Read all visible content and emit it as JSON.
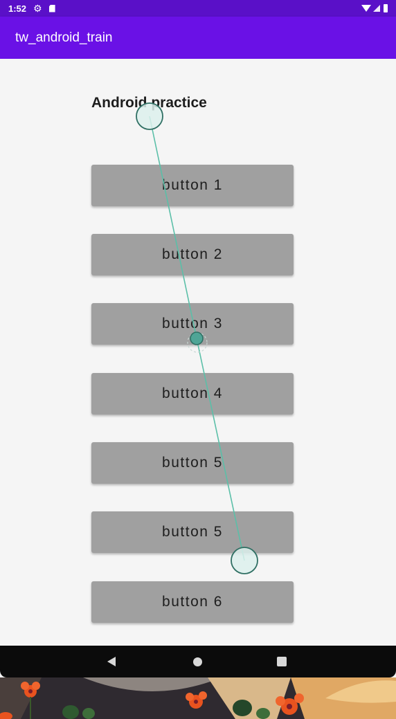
{
  "status_bar": {
    "time": "1:52",
    "icons": [
      "gear-icon",
      "sd-card-icon",
      "wifi-icon",
      "signal-icon",
      "battery-icon"
    ]
  },
  "app_bar": {
    "title": "tw_android_train",
    "color": "#6a11e6"
  },
  "main": {
    "heading": "Android practice",
    "buttons": [
      {
        "label": "button 1"
      },
      {
        "label": "button 2"
      },
      {
        "label": "button 3"
      },
      {
        "label": "button 4"
      },
      {
        "label": "button 5"
      },
      {
        "label": "button 5"
      },
      {
        "label": "button 6"
      }
    ]
  },
  "nav_bar": {
    "icons": [
      "back-icon",
      "home-icon",
      "recents-icon"
    ]
  },
  "colors": {
    "status_bar": "#5a10c8",
    "app_bar": "#6a11e6",
    "background": "#f5f5f5",
    "button": "#a0a0a0",
    "touch_trail": "#5bbfa8"
  }
}
